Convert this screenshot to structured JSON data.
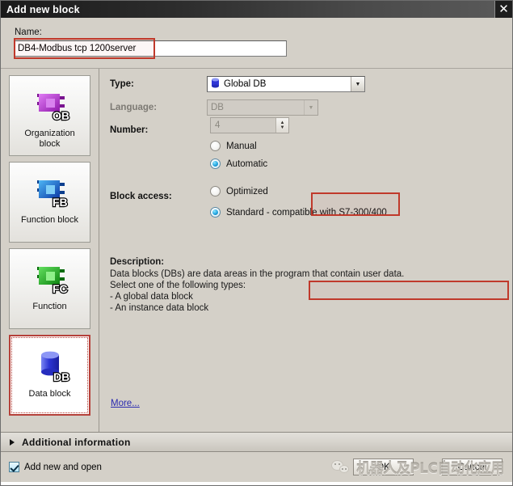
{
  "window": {
    "title": "Add new block",
    "close_icon": "close-icon"
  },
  "name_section": {
    "label": "Name:",
    "value": "DB4-Modbus tcp 1200server",
    "placeholder": ""
  },
  "palette": {
    "items": [
      {
        "id": "organization-block",
        "abbr": "OB",
        "caption": "Organization block",
        "color": "#b327c9",
        "selected": false
      },
      {
        "id": "function-block",
        "abbr": "FB",
        "caption": "Function block",
        "color": "#1464d8",
        "selected": false
      },
      {
        "id": "function",
        "abbr": "FC",
        "caption": "Function",
        "color": "#16a81a",
        "selected": false
      },
      {
        "id": "data-block",
        "abbr": "DB",
        "caption": "Data block",
        "color": "#2f36d6",
        "selected": true
      }
    ]
  },
  "form": {
    "type_label": "Type:",
    "type_value": "Global DB",
    "type_icon": "database-cylinder-icon",
    "language_label": "Language:",
    "language_value": "DB",
    "number_label": "Number:",
    "number_value": "4",
    "number_radios": [
      {
        "label": "Manual",
        "selected": false
      },
      {
        "label": "Automatic",
        "selected": true
      }
    ],
    "block_access_label": "Block access:",
    "block_access_radios": [
      {
        "label": "Optimized",
        "selected": false
      },
      {
        "label": "Standard - compatible with S7-300/400",
        "selected": true
      }
    ],
    "description_title": "Description:",
    "description_lines": [
      "Data blocks (DBs) are data areas in the program that contain user data.",
      "Select one of the following types:",
      "- A global data block",
      "- An instance data block"
    ],
    "more_link": "More..."
  },
  "additional_information": {
    "label": "Additional information",
    "expander_icon": "chevron-right-icon"
  },
  "footer": {
    "checkbox_label": "Add new and open",
    "checkbox_checked": true,
    "ok_label": "OK",
    "cancel_label": "Cancel"
  },
  "watermark": {
    "text": "机器人及PLC自动化应用",
    "icon": "wechat-icon"
  },
  "highlights": {
    "accent_red": "#c0392b",
    "selection_red": "#b5413a"
  }
}
